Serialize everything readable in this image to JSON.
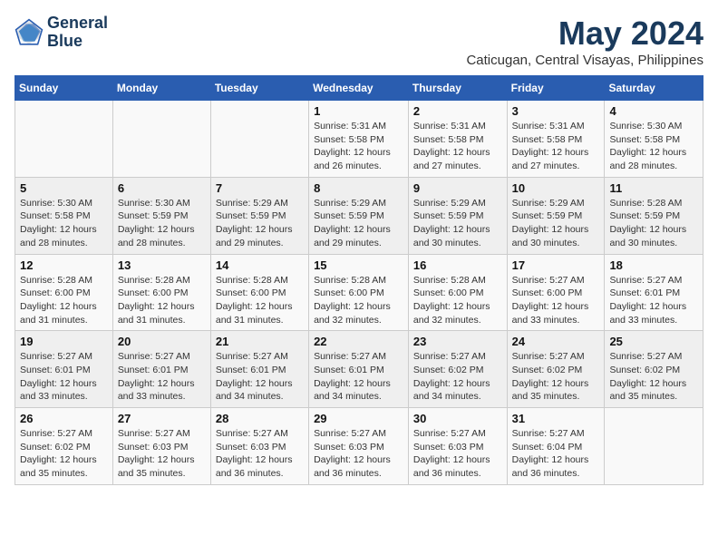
{
  "header": {
    "logo_line1": "General",
    "logo_line2": "Blue",
    "month_year": "May 2024",
    "location": "Caticugan, Central Visayas, Philippines"
  },
  "days_of_week": [
    "Sunday",
    "Monday",
    "Tuesday",
    "Wednesday",
    "Thursday",
    "Friday",
    "Saturday"
  ],
  "weeks": [
    [
      {
        "day": "",
        "info": ""
      },
      {
        "day": "",
        "info": ""
      },
      {
        "day": "",
        "info": ""
      },
      {
        "day": "1",
        "info": "Sunrise: 5:31 AM\nSunset: 5:58 PM\nDaylight: 12 hours and 26 minutes."
      },
      {
        "day": "2",
        "info": "Sunrise: 5:31 AM\nSunset: 5:58 PM\nDaylight: 12 hours and 27 minutes."
      },
      {
        "day": "3",
        "info": "Sunrise: 5:31 AM\nSunset: 5:58 PM\nDaylight: 12 hours and 27 minutes."
      },
      {
        "day": "4",
        "info": "Sunrise: 5:30 AM\nSunset: 5:58 PM\nDaylight: 12 hours and 28 minutes."
      }
    ],
    [
      {
        "day": "5",
        "info": "Sunrise: 5:30 AM\nSunset: 5:58 PM\nDaylight: 12 hours and 28 minutes."
      },
      {
        "day": "6",
        "info": "Sunrise: 5:30 AM\nSunset: 5:59 PM\nDaylight: 12 hours and 28 minutes."
      },
      {
        "day": "7",
        "info": "Sunrise: 5:29 AM\nSunset: 5:59 PM\nDaylight: 12 hours and 29 minutes."
      },
      {
        "day": "8",
        "info": "Sunrise: 5:29 AM\nSunset: 5:59 PM\nDaylight: 12 hours and 29 minutes."
      },
      {
        "day": "9",
        "info": "Sunrise: 5:29 AM\nSunset: 5:59 PM\nDaylight: 12 hours and 30 minutes."
      },
      {
        "day": "10",
        "info": "Sunrise: 5:29 AM\nSunset: 5:59 PM\nDaylight: 12 hours and 30 minutes."
      },
      {
        "day": "11",
        "info": "Sunrise: 5:28 AM\nSunset: 5:59 PM\nDaylight: 12 hours and 30 minutes."
      }
    ],
    [
      {
        "day": "12",
        "info": "Sunrise: 5:28 AM\nSunset: 6:00 PM\nDaylight: 12 hours and 31 minutes."
      },
      {
        "day": "13",
        "info": "Sunrise: 5:28 AM\nSunset: 6:00 PM\nDaylight: 12 hours and 31 minutes."
      },
      {
        "day": "14",
        "info": "Sunrise: 5:28 AM\nSunset: 6:00 PM\nDaylight: 12 hours and 31 minutes."
      },
      {
        "day": "15",
        "info": "Sunrise: 5:28 AM\nSunset: 6:00 PM\nDaylight: 12 hours and 32 minutes."
      },
      {
        "day": "16",
        "info": "Sunrise: 5:28 AM\nSunset: 6:00 PM\nDaylight: 12 hours and 32 minutes."
      },
      {
        "day": "17",
        "info": "Sunrise: 5:27 AM\nSunset: 6:00 PM\nDaylight: 12 hours and 33 minutes."
      },
      {
        "day": "18",
        "info": "Sunrise: 5:27 AM\nSunset: 6:01 PM\nDaylight: 12 hours and 33 minutes."
      }
    ],
    [
      {
        "day": "19",
        "info": "Sunrise: 5:27 AM\nSunset: 6:01 PM\nDaylight: 12 hours and 33 minutes."
      },
      {
        "day": "20",
        "info": "Sunrise: 5:27 AM\nSunset: 6:01 PM\nDaylight: 12 hours and 33 minutes."
      },
      {
        "day": "21",
        "info": "Sunrise: 5:27 AM\nSunset: 6:01 PM\nDaylight: 12 hours and 34 minutes."
      },
      {
        "day": "22",
        "info": "Sunrise: 5:27 AM\nSunset: 6:01 PM\nDaylight: 12 hours and 34 minutes."
      },
      {
        "day": "23",
        "info": "Sunrise: 5:27 AM\nSunset: 6:02 PM\nDaylight: 12 hours and 34 minutes."
      },
      {
        "day": "24",
        "info": "Sunrise: 5:27 AM\nSunset: 6:02 PM\nDaylight: 12 hours and 35 minutes."
      },
      {
        "day": "25",
        "info": "Sunrise: 5:27 AM\nSunset: 6:02 PM\nDaylight: 12 hours and 35 minutes."
      }
    ],
    [
      {
        "day": "26",
        "info": "Sunrise: 5:27 AM\nSunset: 6:02 PM\nDaylight: 12 hours and 35 minutes."
      },
      {
        "day": "27",
        "info": "Sunrise: 5:27 AM\nSunset: 6:03 PM\nDaylight: 12 hours and 35 minutes."
      },
      {
        "day": "28",
        "info": "Sunrise: 5:27 AM\nSunset: 6:03 PM\nDaylight: 12 hours and 36 minutes."
      },
      {
        "day": "29",
        "info": "Sunrise: 5:27 AM\nSunset: 6:03 PM\nDaylight: 12 hours and 36 minutes."
      },
      {
        "day": "30",
        "info": "Sunrise: 5:27 AM\nSunset: 6:03 PM\nDaylight: 12 hours and 36 minutes."
      },
      {
        "day": "31",
        "info": "Sunrise: 5:27 AM\nSunset: 6:04 PM\nDaylight: 12 hours and 36 minutes."
      },
      {
        "day": "",
        "info": ""
      }
    ]
  ]
}
